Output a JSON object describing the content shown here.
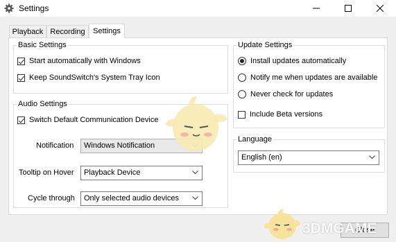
{
  "window": {
    "title": "Settings"
  },
  "tabs": [
    {
      "label": "Playback",
      "active": false
    },
    {
      "label": "Recording",
      "active": false
    },
    {
      "label": "Settings",
      "active": true
    }
  ],
  "basic_settings": {
    "title": "Basic Settings",
    "items": [
      {
        "label": "Start automatically with Windows",
        "checked": true
      },
      {
        "label": "Keep SoundSwitch's System Tray Icon",
        "checked": true
      }
    ]
  },
  "audio_settings": {
    "title": "Audio Settings",
    "switch_default": {
      "label": "Switch Default Communication Device",
      "checked": true
    },
    "notification": {
      "label": "Notification",
      "value": "Windows Notification",
      "enabled": false
    },
    "tooltip": {
      "label": "Tooltip on Hover",
      "value": "Playback Device"
    },
    "cycle": {
      "label": "Cycle through",
      "value": "Only selected audio devices"
    }
  },
  "update_settings": {
    "title": "Update Settings",
    "options": [
      {
        "label": "Install updates automatically",
        "selected": true
      },
      {
        "label": "Notify me when updates are available",
        "selected": false
      },
      {
        "label": "Never check for updates",
        "selected": false
      }
    ],
    "beta": {
      "label": "Include Beta versions",
      "checked": false
    }
  },
  "language": {
    "title": "Language",
    "value": "English (en)"
  },
  "buttons": {
    "close": "Close"
  },
  "watermark": {
    "text": "3DMGAME"
  },
  "colors": {
    "titlebar_bg": "#ffffff",
    "window_bg": "#f0f0f0",
    "panel_bg": "#ffffff",
    "mascot": "#f5e6a8"
  }
}
